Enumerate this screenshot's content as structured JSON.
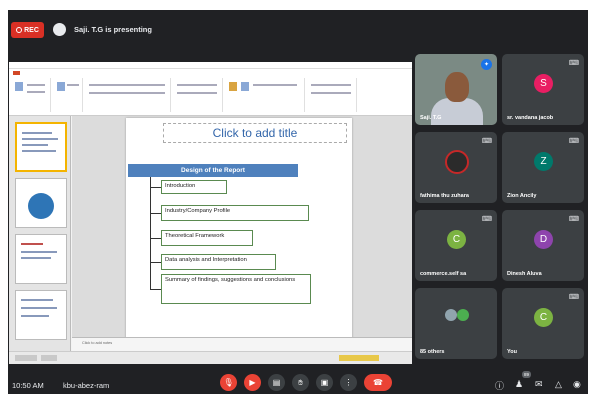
{
  "topbar": {
    "rec_label": "REC",
    "presenting_text": "Saji. T.G is presenting"
  },
  "powerpoint": {
    "slide": {
      "title_placeholder": "Click to add title",
      "heading": "Design of the Report",
      "items": [
        "Introduction",
        "Industry/Company Profile",
        "Theoretical Framework",
        "Data analysis and Interpretation",
        "Summary of findings, suggestions and conclusions"
      ]
    },
    "notes_placeholder": "Click to add notes"
  },
  "participants": [
    {
      "name": "Saji. T.G",
      "type": "video",
      "pinned": true
    },
    {
      "name": "sr. vandana jacob",
      "initial": "S",
      "color": "#e91e63",
      "muted": true
    },
    {
      "name": "fathima thu zuhara",
      "type": "photo",
      "muted": true
    },
    {
      "name": "Zion Ancily",
      "initial": "Z",
      "color": "#00796b",
      "muted": true
    },
    {
      "name": "commerce.self sa",
      "initial": "C",
      "color": "#7cb342",
      "muted": true
    },
    {
      "name": "Dinesh Aluva",
      "initial": "D",
      "color": "#8e44ad",
      "muted": true
    },
    {
      "name": "85 others",
      "type": "others"
    },
    {
      "name": "You",
      "initial": "C",
      "color": "#7cb342",
      "muted": true
    }
  ],
  "bottombar": {
    "time": "10:50 AM",
    "meeting_code": "kbu-abez-ram",
    "people_count": "89"
  },
  "icons": {
    "mic": "mic-off-icon",
    "camera": "camera-off-icon",
    "captions": "captions-icon",
    "hand": "raise-hand-icon",
    "present": "present-icon",
    "more": "more-options-icon",
    "end": "end-call-icon",
    "info": "info-icon",
    "people": "people-icon",
    "chat": "chat-icon",
    "activities": "activities-icon",
    "lock": "host-controls-icon"
  }
}
